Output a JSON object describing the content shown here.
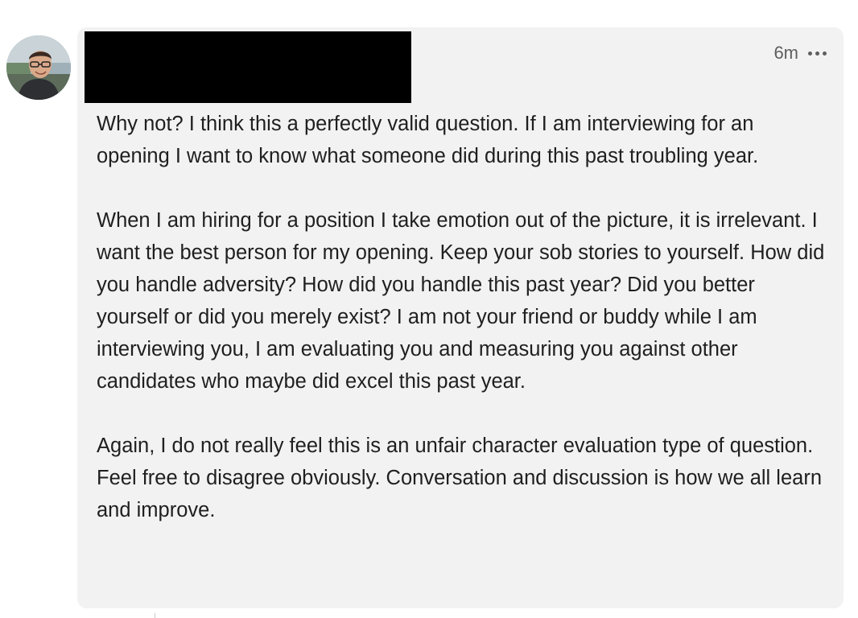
{
  "comment": {
    "author_avatar_icon": "profile-photo",
    "timestamp": "6m",
    "more_icon": "ellipsis-icon",
    "paragraphs": [
      "Why not? I think this a perfectly valid question. If I am interviewing for an opening I want to know what someone did during this past troubling year.",
      "When I am hiring for a position I take emotion out of the picture, it is irrelevant. I want the best person for my opening. Keep your sob stories to yourself. How did you handle adversity? How did you handle this past year? Did you better yourself or did you merely exist? I am not your friend or buddy while I am interviewing you, I am evaluating you and measuring you against other candidates who maybe did excel this past year.",
      "Again, I do not really feel this is an unfair character evaluation type of question. Feel free to disagree obviously. Conversation and discussion is how we all learn and improve."
    ]
  },
  "colors": {
    "bubble_background": "#f2f2f2",
    "text": "#1f1f1f",
    "meta_text": "#5e5e5e",
    "redaction": "#000000"
  }
}
